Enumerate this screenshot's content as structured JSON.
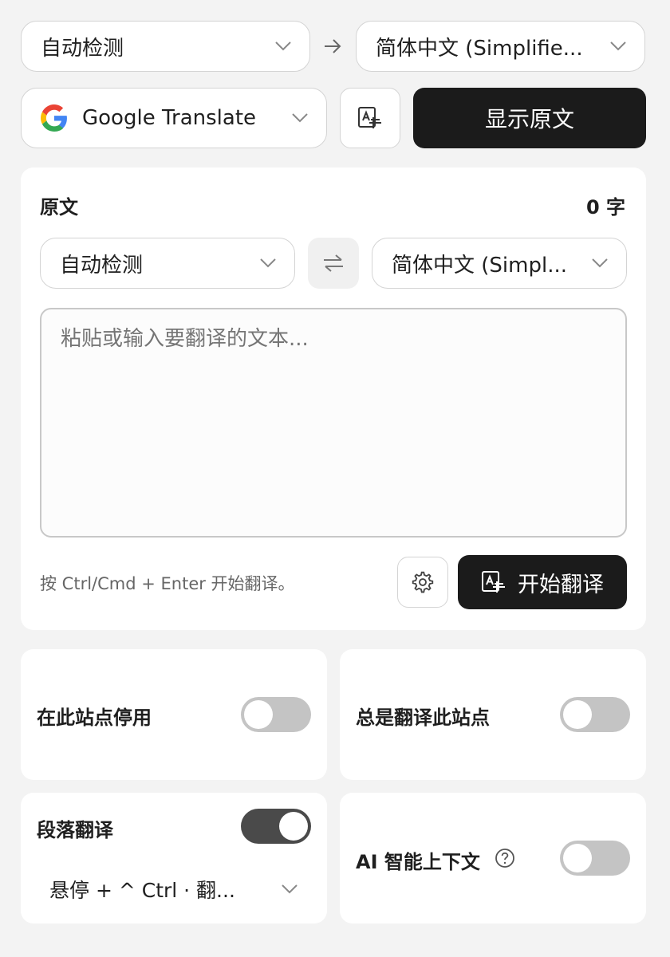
{
  "top": {
    "source_lang": "自动检测",
    "target_lang": "简体中文 (Simplifie...",
    "service": "Google Translate",
    "show_original_label": "显示原文"
  },
  "panel": {
    "title": "原文",
    "char_count": "0 字",
    "source_lang": "自动检测",
    "target_lang": "简体中文 (Simpl...",
    "input_placeholder": "粘贴或输入要翻译的文本...",
    "hint": "按 Ctrl/Cmd + Enter 开始翻译。",
    "translate_label": "开始翻译"
  },
  "options": {
    "disable_site": {
      "label": "在此站点停用",
      "on": false
    },
    "always_translate": {
      "label": "总是翻译此站点",
      "on": false
    },
    "paragraph": {
      "label": "段落翻译",
      "on": true,
      "shortcut": "悬停 + ^ Ctrl · 翻..."
    },
    "ai_context": {
      "label": "AI 智能上下文",
      "on": false
    }
  },
  "colors": {
    "dark": "#1b1b1b",
    "toggle_off": "#c4c4c4",
    "toggle_on": "#4a4a4a"
  },
  "icons": [
    "chevron-down-icon",
    "arrow-right-icon",
    "google-logo-icon",
    "image-translate-icon",
    "swap-icon",
    "gear-icon",
    "help-circle-icon"
  ]
}
